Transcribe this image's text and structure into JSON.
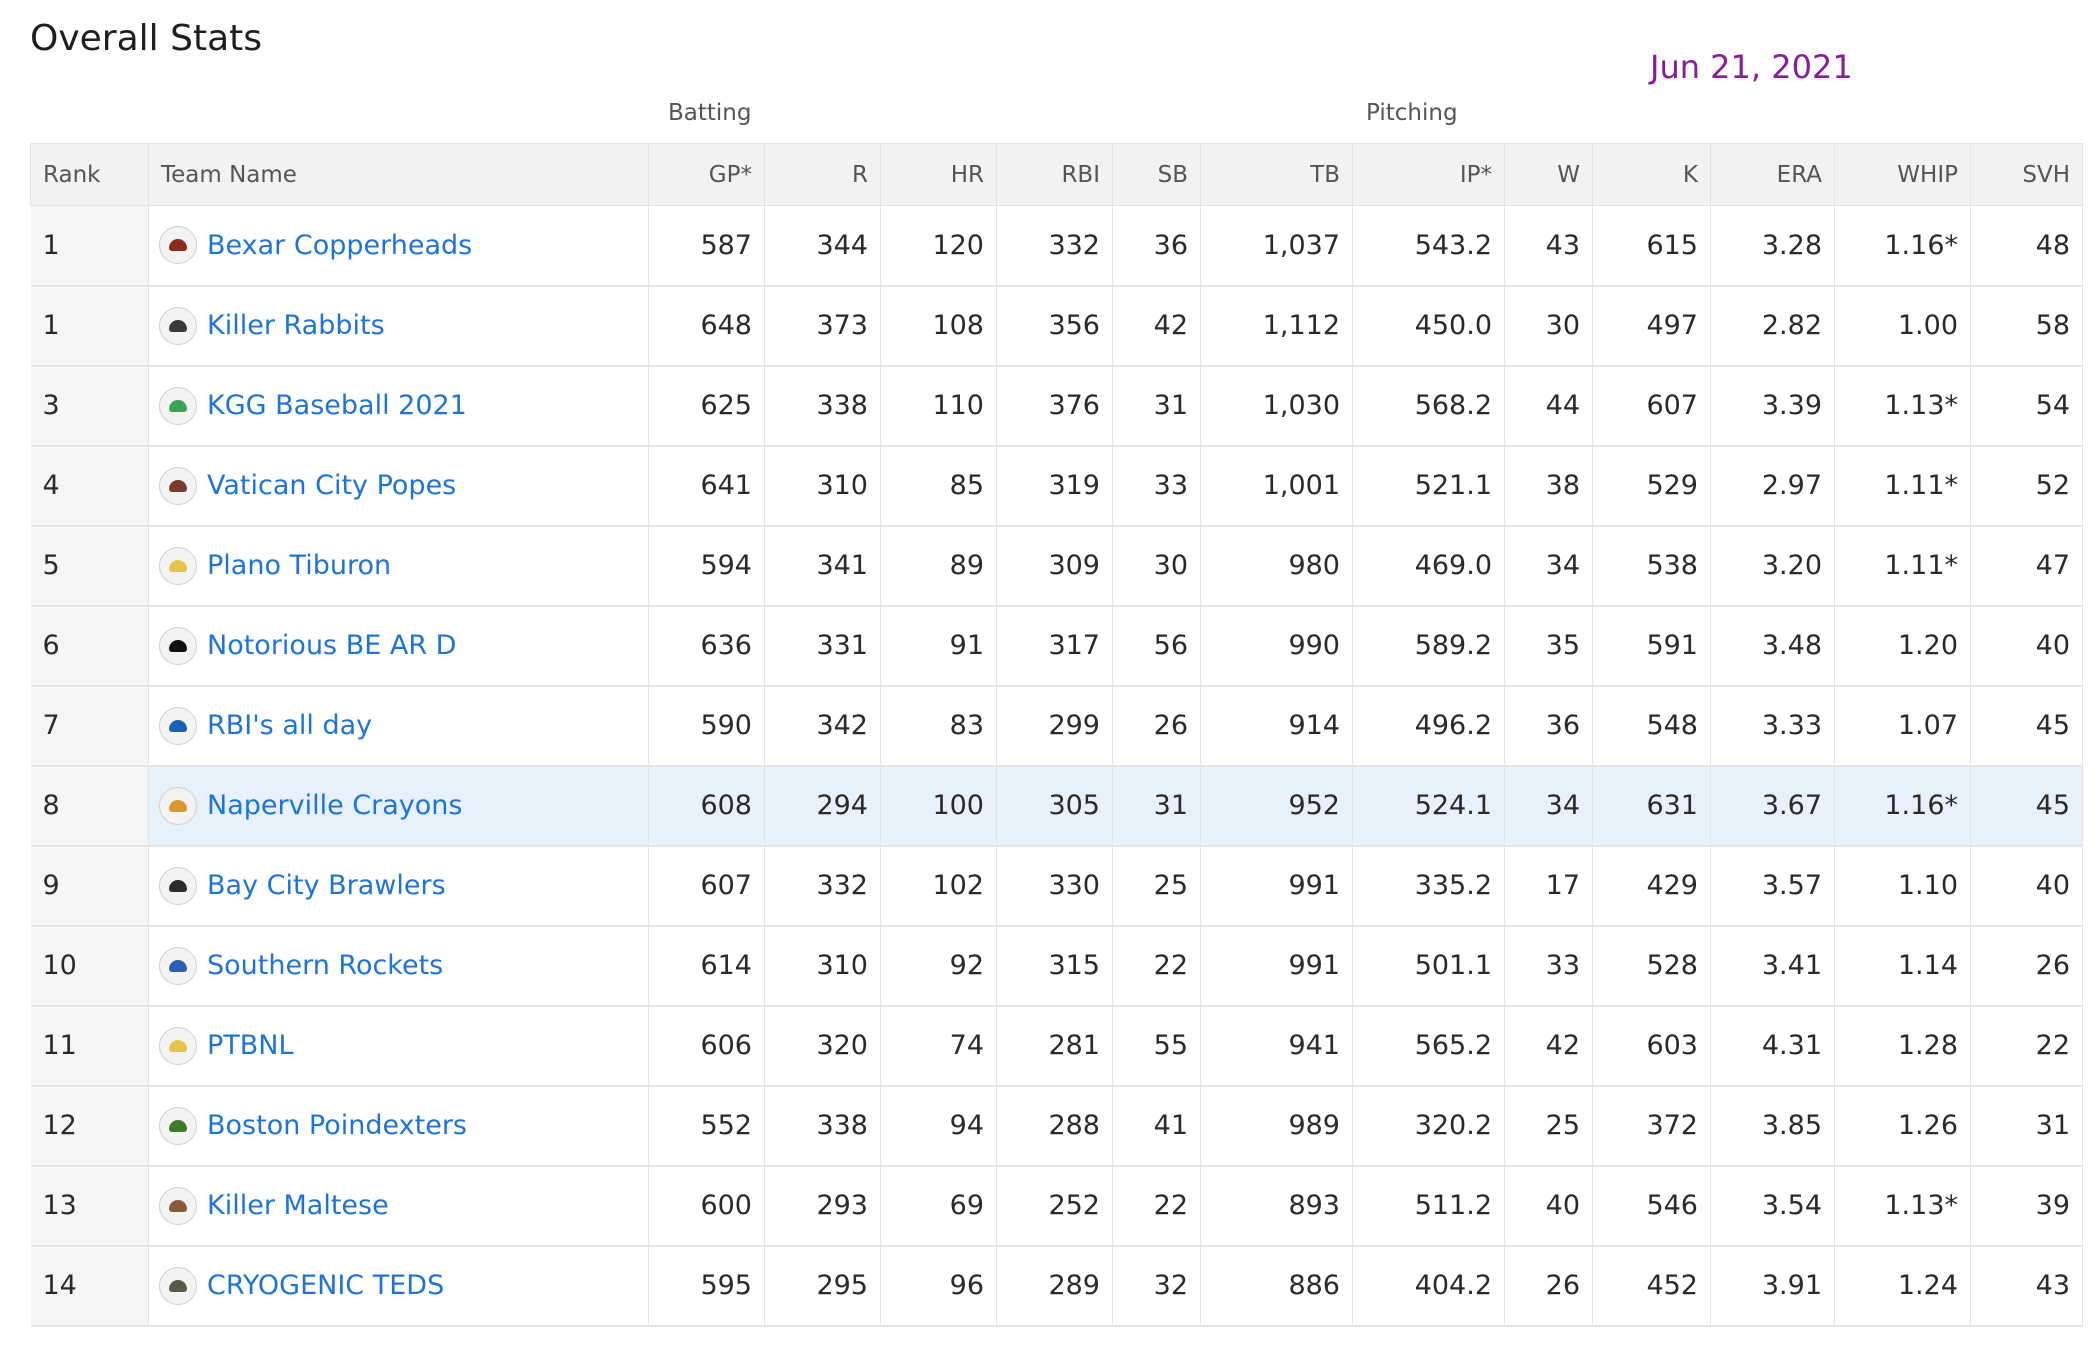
{
  "page": {
    "title": "Overall Stats",
    "date": "Jun 21, 2021",
    "groups": {
      "batting": "Batting",
      "pitching": "Pitching"
    }
  },
  "colors": {
    "link": "#1f73d8",
    "date": "#8a1b9b",
    "highlight_row": "#e7f1fb",
    "header_bg": "#f2f2f2"
  },
  "table": {
    "columns": [
      "Rank",
      "Team Name",
      "GP*",
      "R",
      "HR",
      "RBI",
      "SB",
      "TB",
      "IP*",
      "W",
      "K",
      "ERA",
      "WHIP",
      "SVH"
    ],
    "rows": [
      {
        "rank": "1",
        "team": "Bexar Copperheads",
        "icon": "snake-logo-icon",
        "logo_color": "#8b2a1e",
        "gp": "587",
        "r": "344",
        "hr": "120",
        "rbi": "332",
        "sb": "36",
        "tb": "1,037",
        "ip": "543.2",
        "w": "43",
        "k": "615",
        "era": "3.28",
        "whip": "1.16*",
        "whip_flagged": true,
        "svh": "48"
      },
      {
        "rank": "1",
        "team": "Killer Rabbits",
        "icon": "rabbit-logo-icon",
        "logo_color": "#3a3a3a",
        "gp": "648",
        "r": "373",
        "hr": "108",
        "rbi": "356",
        "sb": "42",
        "tb": "1,112",
        "ip": "450.0",
        "w": "30",
        "k": "497",
        "era": "2.82",
        "whip": "1.00",
        "whip_flagged": false,
        "svh": "58"
      },
      {
        "rank": "3",
        "team": "KGG Baseball 2021",
        "icon": "green-cap-logo-icon",
        "logo_color": "#3aa35b",
        "gp": "625",
        "r": "338",
        "hr": "110",
        "rbi": "376",
        "sb": "31",
        "tb": "1,030",
        "ip": "568.2",
        "w": "44",
        "k": "607",
        "era": "3.39",
        "whip": "1.13*",
        "whip_flagged": true,
        "svh": "54"
      },
      {
        "rank": "4",
        "team": "Vatican City Popes",
        "icon": "pope-logo-icon",
        "logo_color": "#7a3b2e",
        "gp": "641",
        "r": "310",
        "hr": "85",
        "rbi": "319",
        "sb": "33",
        "tb": "1,001",
        "ip": "521.1",
        "w": "38",
        "k": "529",
        "era": "2.97",
        "whip": "1.11*",
        "whip_flagged": true,
        "svh": "52"
      },
      {
        "rank": "5",
        "team": "Plano Tiburon",
        "icon": "yellow-cap-logo-icon",
        "logo_color": "#e8c24a",
        "gp": "594",
        "r": "341",
        "hr": "89",
        "rbi": "309",
        "sb": "30",
        "tb": "980",
        "ip": "469.0",
        "w": "34",
        "k": "538",
        "era": "3.20",
        "whip": "1.11*",
        "whip_flagged": true,
        "svh": "47"
      },
      {
        "rank": "6",
        "team": "Notorious BE AR D",
        "icon": "bear-logo-icon",
        "logo_color": "#111111",
        "gp": "636",
        "r": "331",
        "hr": "91",
        "rbi": "317",
        "sb": "56",
        "tb": "990",
        "ip": "589.2",
        "w": "35",
        "k": "591",
        "era": "3.48",
        "whip": "1.20",
        "whip_flagged": false,
        "svh": "40"
      },
      {
        "rank": "7",
        "team": "RBI's all day",
        "icon": "blue-cap-logo-icon",
        "logo_color": "#1c5fb8",
        "gp": "590",
        "r": "342",
        "hr": "83",
        "rbi": "299",
        "sb": "26",
        "tb": "914",
        "ip": "496.2",
        "w": "36",
        "k": "548",
        "era": "3.33",
        "whip": "1.07",
        "whip_flagged": false,
        "svh": "45"
      },
      {
        "rank": "8",
        "team": "Naperville Crayons",
        "icon": "totem-logo-icon",
        "logo_color": "#d99a2b",
        "gp": "608",
        "r": "294",
        "hr": "100",
        "rbi": "305",
        "sb": "31",
        "tb": "952",
        "ip": "524.1",
        "w": "34",
        "k": "631",
        "era": "3.67",
        "whip": "1.16*",
        "whip_flagged": true,
        "svh": "45",
        "highlight": true
      },
      {
        "rank": "9",
        "team": "Bay City Brawlers",
        "icon": "dog-logo-icon",
        "logo_color": "#2b2b2b",
        "gp": "607",
        "r": "332",
        "hr": "102",
        "rbi": "330",
        "sb": "25",
        "tb": "991",
        "ip": "335.2",
        "w": "17",
        "k": "429",
        "era": "3.57",
        "whip": "1.10",
        "whip_flagged": false,
        "svh": "40"
      },
      {
        "rank": "10",
        "team": "Southern Rockets",
        "icon": "rocket-logo-icon",
        "logo_color": "#2f5fb3",
        "gp": "614",
        "r": "310",
        "hr": "92",
        "rbi": "315",
        "sb": "22",
        "tb": "991",
        "ip": "501.1",
        "w": "33",
        "k": "528",
        "era": "3.41",
        "whip": "1.14",
        "whip_flagged": false,
        "svh": "26"
      },
      {
        "rank": "11",
        "team": "PTBNL",
        "icon": "yellow-cap-logo-icon",
        "logo_color": "#e8c24a",
        "gp": "606",
        "r": "320",
        "hr": "74",
        "rbi": "281",
        "sb": "55",
        "tb": "941",
        "ip": "565.2",
        "w": "42",
        "k": "603",
        "era": "4.31",
        "whip": "1.28",
        "whip_flagged": false,
        "svh": "22"
      },
      {
        "rank": "12",
        "team": "Boston Poindexters",
        "icon": "gator-logo-icon",
        "logo_color": "#3f7a2a",
        "gp": "552",
        "r": "338",
        "hr": "94",
        "rbi": "288",
        "sb": "41",
        "tb": "989",
        "ip": "320.2",
        "w": "25",
        "k": "372",
        "era": "3.85",
        "whip": "1.26",
        "whip_flagged": false,
        "svh": "31"
      },
      {
        "rank": "13",
        "team": "Killer Maltese",
        "icon": "dog-logo-icon",
        "logo_color": "#8a5a3c",
        "gp": "600",
        "r": "293",
        "hr": "69",
        "rbi": "252",
        "sb": "22",
        "tb": "893",
        "ip": "511.2",
        "w": "40",
        "k": "546",
        "era": "3.54",
        "whip": "1.13*",
        "whip_flagged": true,
        "svh": "39"
      },
      {
        "rank": "14",
        "team": "CRYOGENIC TEDS",
        "icon": "jar-logo-icon",
        "logo_color": "#5a5a4a",
        "gp": "595",
        "r": "295",
        "hr": "96",
        "rbi": "289",
        "sb": "32",
        "tb": "886",
        "ip": "404.2",
        "w": "26",
        "k": "452",
        "era": "3.91",
        "whip": "1.24",
        "whip_flagged": false,
        "svh": "43"
      }
    ]
  }
}
